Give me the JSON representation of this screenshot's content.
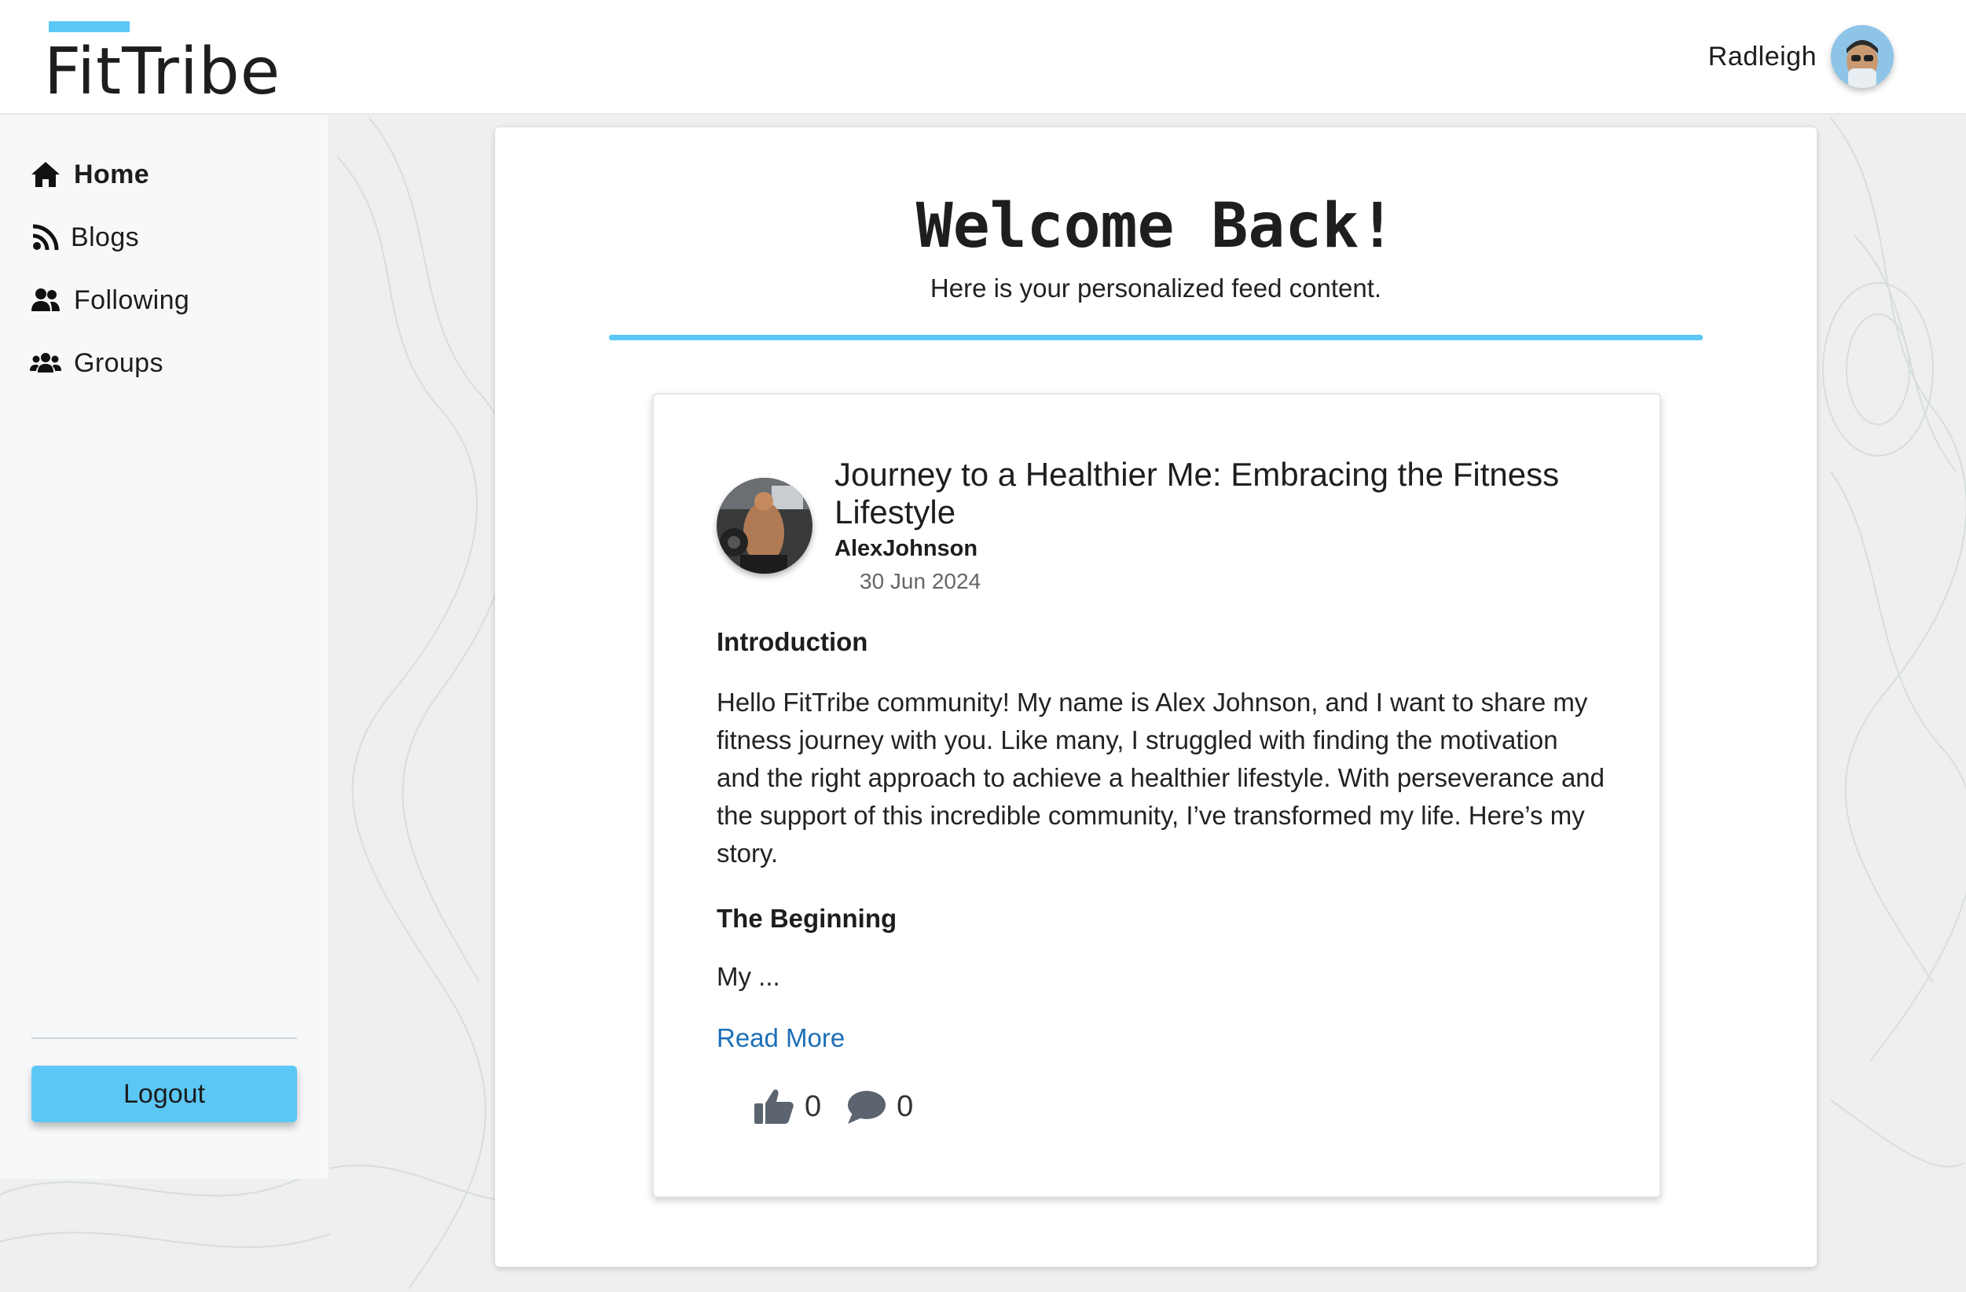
{
  "app": {
    "name": "FitTribe",
    "accent_color": "#5bc7f5"
  },
  "header": {
    "user_name": "Radleigh",
    "avatar_icon": "memoji-avatar-icon"
  },
  "sidebar": {
    "items": [
      {
        "label": "Home",
        "icon": "home-icon",
        "active": true
      },
      {
        "label": "Blogs",
        "icon": "rss-icon",
        "active": false
      },
      {
        "label": "Following",
        "icon": "user-friends-icon",
        "active": false
      },
      {
        "label": "Groups",
        "icon": "users-icon",
        "active": false
      }
    ],
    "logout_label": "Logout"
  },
  "feed": {
    "welcome_title": "Welcome Back!",
    "welcome_subtitle": "Here is your personalized feed content."
  },
  "post": {
    "title": "Journey to a Healthier Me: Embracing the Fitness Lifestyle",
    "author": "AlexJohnson",
    "date": "30 Jun 2024",
    "heading_1": "Introduction",
    "paragraph_1": "Hello FitTribe community! My name is Alex Johnson, and I want to share my fitness journey with you. Like many, I struggled with finding the motivation and the right approach to achieve a healthier lifestyle. With perseverance and the support of this incredible community, I’ve transformed my life. Here’s my story.",
    "heading_2": "The Beginning",
    "paragraph_2": "My ...",
    "read_more_label": "Read More",
    "likes": "0",
    "comments": "0"
  }
}
